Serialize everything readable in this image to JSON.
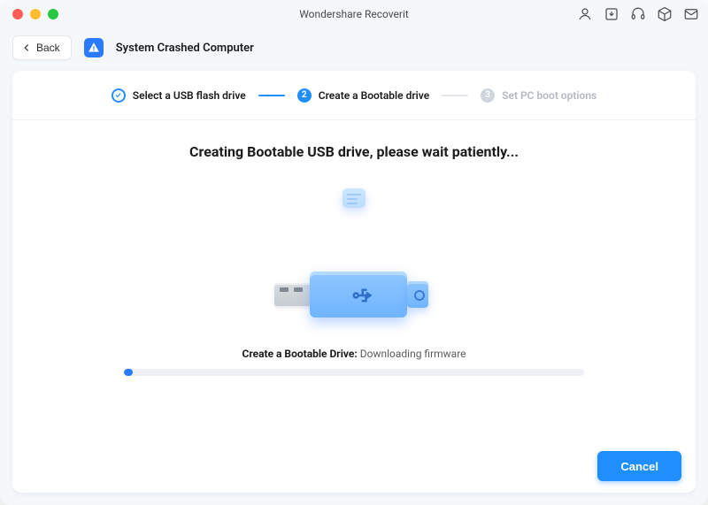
{
  "app": {
    "title": "Wondershare Recoverit"
  },
  "toolbar": {
    "back_label": "Back"
  },
  "breadcrumb": {
    "section": "System Crashed Computer"
  },
  "stepper": {
    "step1": {
      "label": "Select a USB flash drive",
      "state": "done"
    },
    "step2": {
      "label": "Create a Bootable drive",
      "number": "2",
      "state": "active"
    },
    "step3": {
      "label": "Set PC boot options",
      "number": "3",
      "state": "pending"
    }
  },
  "main": {
    "heading": "Creating Bootable USB drive, please wait patiently...",
    "status_label": "Create a Bootable Drive:",
    "status_value": "Downloading firmware",
    "progress_percent": 2
  },
  "footer": {
    "cancel_label": "Cancel"
  },
  "icons": {
    "account": "account-icon",
    "import": "import-icon",
    "support": "support-icon",
    "cube": "cube-icon",
    "mail": "mail-icon"
  },
  "colors": {
    "accent": "#1f8fff"
  }
}
